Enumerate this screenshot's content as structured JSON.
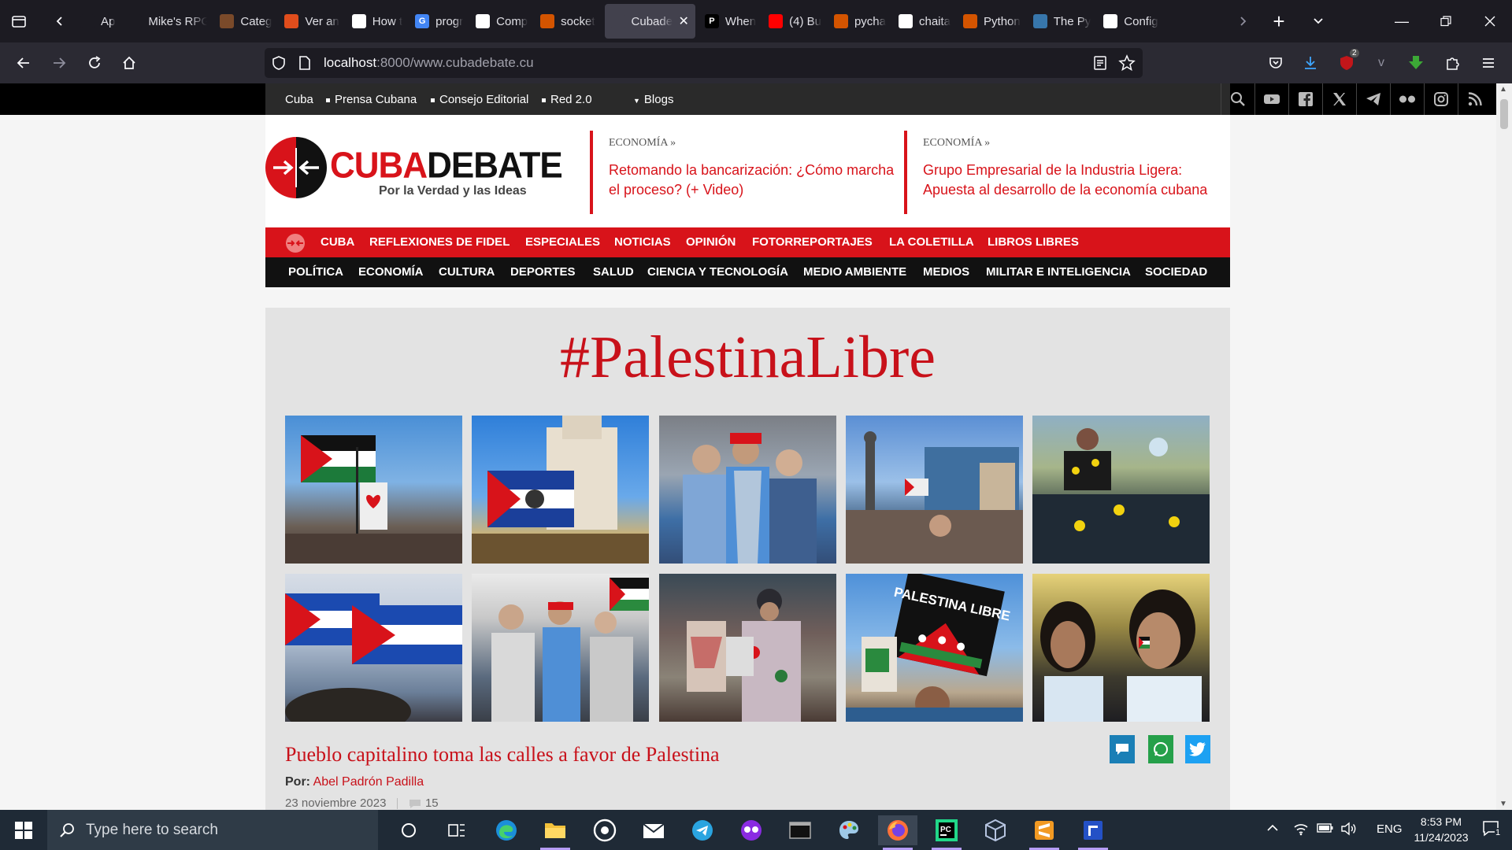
{
  "browser": {
    "tabs": [
      {
        "label": "Ap",
        "icon": "",
        "color": "#1c1b22"
      },
      {
        "label": "Mike's RPG",
        "icon": "",
        "color": "#1c1b22"
      },
      {
        "label": "Categ",
        "icon": "",
        "color": "#7a4a2a"
      },
      {
        "label": "Ver an",
        "icon": "",
        "color": "#e04d1c"
      },
      {
        "label": "How t",
        "icon": "",
        "color": "#ffffff"
      },
      {
        "label": "progr",
        "icon": "G",
        "color": "#4285f4"
      },
      {
        "label": "Comp",
        "icon": "",
        "color": "#ffffff"
      },
      {
        "label": "socket",
        "icon": "",
        "color": "#d35400"
      },
      {
        "label": "Cubade",
        "icon": "",
        "color": "#42414d"
      },
      {
        "label": "When",
        "icon": "P",
        "color": "#000000"
      },
      {
        "label": "(4) Bu",
        "icon": "",
        "color": "#ff0000"
      },
      {
        "label": "pycha",
        "icon": "",
        "color": "#d35400"
      },
      {
        "label": "chaita",
        "icon": "",
        "color": "#ffffff"
      },
      {
        "label": "Python",
        "icon": "",
        "color": "#d35400"
      },
      {
        "label": "The Py",
        "icon": "",
        "color": "#3776ab"
      },
      {
        "label": "Config",
        "icon": "",
        "color": "#ffffff"
      }
    ],
    "url_host": "localhost",
    "url_path": ":8000/www.cubadebate.cu",
    "ext_badge": "2"
  },
  "site": {
    "topbar_links": [
      "Cuba",
      "Prensa Cubana",
      "Consejo Editorial",
      "Red 2.0",
      "Blogs"
    ],
    "logo_word_red": "CUBA",
    "logo_word_dark": "DEBATE",
    "logo_tagline": "Por la Verdad y las Ideas",
    "headlines": [
      {
        "category": "ECONOMÍA",
        "sep": "»",
        "title": "Retomando la bancarización: ¿Cómo marcha el proceso? (+ Video)"
      },
      {
        "category": "ECONOMÍA",
        "sep": "»",
        "title": "Grupo Empresarial de la Industria Ligera: Apuesta al desarrollo de la economía cubana"
      }
    ],
    "menu_primary": [
      "CUBA",
      "REFLEXIONES DE FIDEL",
      "ESPECIALES",
      "NOTICIAS",
      "OPINIÓN",
      "FOTORREPORTAJES",
      "LA COLETILLA",
      "LIBROS LIBRES"
    ],
    "menu_secondary": [
      "POLÍTICA",
      "ECONOMÍA",
      "CULTURA",
      "DEPORTES",
      "SALUD",
      "CIENCIA Y TECNOLOGÍA",
      "MEDIO AMBIENTE",
      "MEDIOS",
      "MILITAR E INTELIGENCIA",
      "SOCIEDAD"
    ],
    "feature": {
      "hashtag": "#PalestinaLibre",
      "photo_sign": "PALESTINA LIBRE",
      "article_title": "Pueblo capitalino toma las calles a favor de Palestina",
      "by_label": "Por:",
      "author": "Abel Padrón Padilla",
      "date": "23 noviembre 2023",
      "comments": "15"
    }
  },
  "taskbar": {
    "search_placeholder": "Type here to search",
    "language": "ENG",
    "time": "8:53 PM",
    "date": "11/24/2023",
    "notif_count": "1"
  }
}
